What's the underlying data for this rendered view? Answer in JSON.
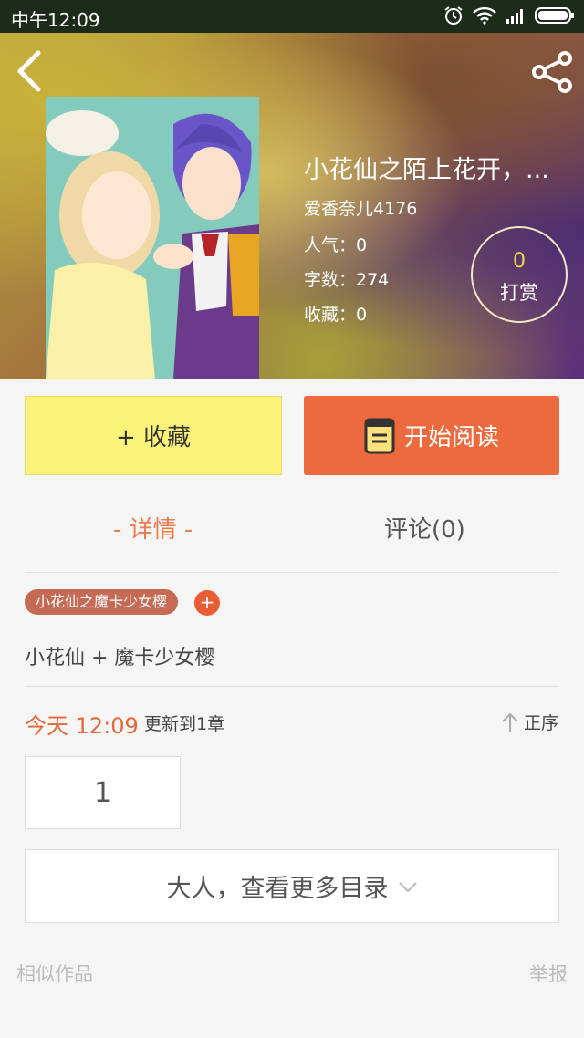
{
  "status_bar": {
    "time": "中午12:09"
  },
  "book": {
    "title": "小花仙之陌上花开，...",
    "author": "爱香奈儿4176",
    "popularity": "人气：0",
    "word_count": "字数：274",
    "favorites": "收藏：0"
  },
  "tip": {
    "count": "0",
    "label": "打赏"
  },
  "actions": {
    "favorite": "+ 收藏",
    "read": "开始阅读"
  },
  "tabs": {
    "detail": "- 详情 -",
    "comments": "评论(0)"
  },
  "tag": {
    "label": "小花仙之魔卡少女樱",
    "add": "+"
  },
  "description": "小花仙 + 魔卡少女樱",
  "update": {
    "time": "今天 12:09",
    "text": "更新到1章",
    "sort": "正序"
  },
  "chapters": [
    "1"
  ],
  "more_catalog": "大人，查看更多目录",
  "footer": {
    "similar": "相似作品",
    "report": "举报"
  },
  "colors": {
    "accent": "#ec6a3d",
    "favorite_button": "#fbf27a",
    "tag": "#c56a55"
  }
}
